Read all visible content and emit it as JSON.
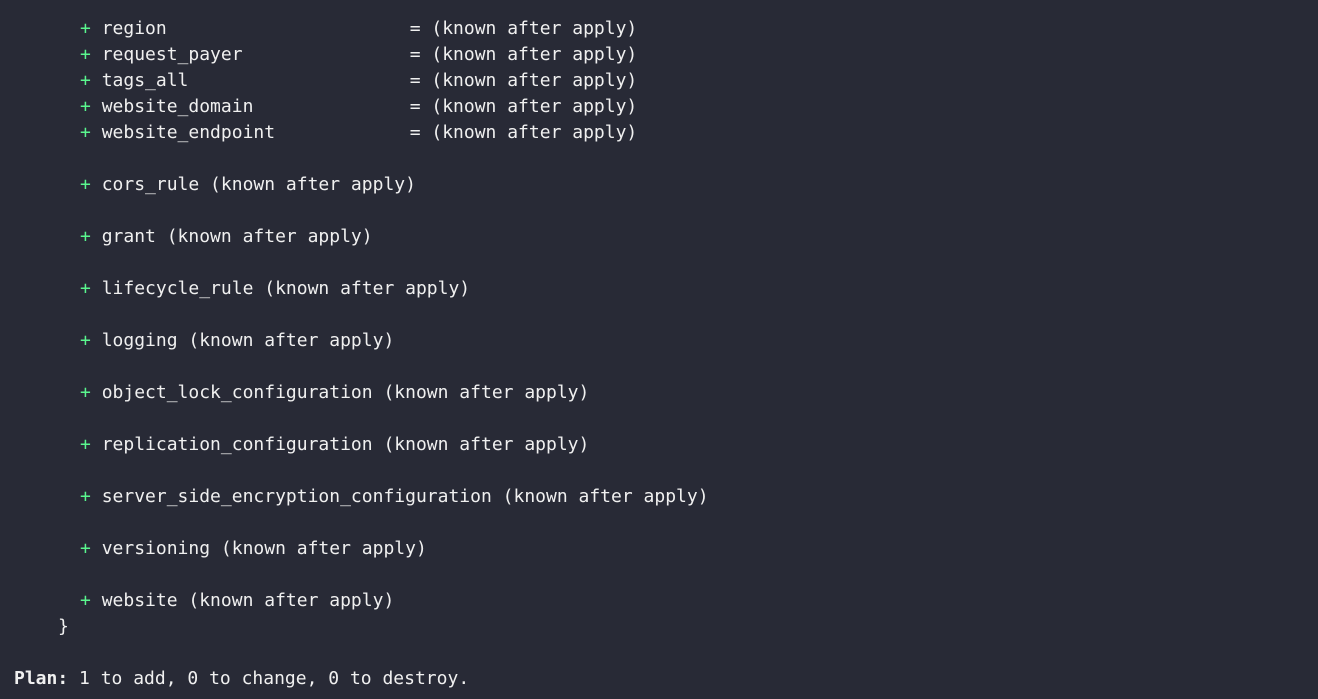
{
  "colors": {
    "background": "#282a36",
    "text": "#f0f0f0",
    "plus": "#5af78e"
  },
  "plus_symbol": "+",
  "attributes": [
    {
      "name": "region",
      "value": "= (known after apply)"
    },
    {
      "name": "request_payer",
      "value": "= (known after apply)"
    },
    {
      "name": "tags_all",
      "value": "= (known after apply)"
    },
    {
      "name": "website_domain",
      "value": "= (known after apply)"
    },
    {
      "name": "website_endpoint",
      "value": "= (known after apply)"
    }
  ],
  "blocks": [
    "cors_rule (known after apply)",
    "grant (known after apply)",
    "lifecycle_rule (known after apply)",
    "logging (known after apply)",
    "object_lock_configuration (known after apply)",
    "replication_configuration (known after apply)",
    "server_side_encryption_configuration (known after apply)",
    "versioning (known after apply)",
    "website (known after apply)"
  ],
  "closing_brace": "}",
  "plan": {
    "label": "Plan:",
    "summary": " 1 to add, 0 to change, 0 to destroy."
  }
}
